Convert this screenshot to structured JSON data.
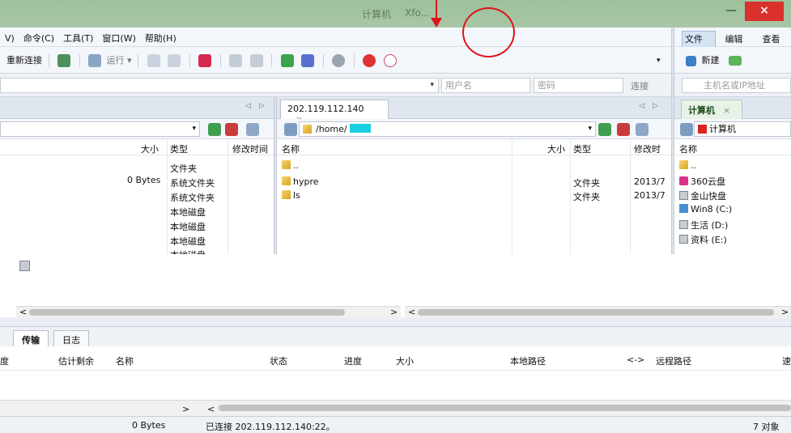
{
  "window": {
    "title_faint": "计算机",
    "title_faint2": "Xfo...",
    "min_glyph": "—",
    "max_glyph": "☐",
    "close_glyph": "×"
  },
  "menu": [
    "V)",
    "命令(C)",
    "工具(T)",
    "窗口(W)",
    "帮助(H)"
  ],
  "right_menu": [
    "文件(F)",
    "编辑(E)",
    "查看("
  ],
  "toolbar": {
    "reconnect": "重新连接",
    "run": "运行 ▾",
    "dropdown_glyph": "▾"
  },
  "right_toolbar": {
    "new": "新建"
  },
  "connect": {
    "username_placeholder": "用户名",
    "password_placeholder": "密码",
    "connect_label": "连接",
    "host_placeholder": "主机名或IP地址"
  },
  "left_pane": {
    "columns": {
      "size": "大小",
      "type": "类型",
      "modified": "修改时间"
    },
    "rows": [
      {
        "size": "",
        "type": "文件夹"
      },
      {
        "size": "0 Bytes",
        "type": "系统文件夹"
      },
      {
        "size": "",
        "type": "系统文件夹"
      },
      {
        "size": "",
        "type": "本地磁盘"
      },
      {
        "size": "",
        "type": "本地磁盘"
      },
      {
        "size": "",
        "type": "本地磁盘"
      },
      {
        "size": "",
        "type": "本地磁盘"
      }
    ]
  },
  "remote_pane": {
    "tab": "202.119.112.140",
    "tab_close": "×",
    "path": "/home/",
    "columns": {
      "name": "名称",
      "size": "大小",
      "type": "类型",
      "modified": "修改时"
    },
    "rows": [
      {
        "name": "..",
        "type": "",
        "modified": ""
      },
      {
        "name": "hypre",
        "type": "文件夹",
        "modified": "2013/7"
      },
      {
        "name": "ls",
        "type": "文件夹",
        "modified": "2013/7"
      }
    ]
  },
  "right_pane": {
    "tab": "计算机",
    "tab_close": "×",
    "path": "计算机",
    "column_name": "名称",
    "items": [
      "..",
      "360云盘",
      "金山快盘",
      "Win8 (C:)",
      "生活 (D:)",
      "资料 (E:)"
    ]
  },
  "transfer": {
    "tabs": [
      "传输",
      "日志"
    ],
    "columns": [
      "度",
      "估计剩余",
      "名称",
      "状态",
      "进度",
      "大小",
      "本地路径",
      "<->",
      "远程路径",
      "速"
    ]
  },
  "scroll": {
    "left_arrow": "<",
    "right_arrow": ">"
  },
  "status": {
    "left": "0 Bytes",
    "connected": "已连接 202.119.112.140:22。",
    "objects": "7 对象"
  },
  "colors": {
    "annotation": "#e0111b",
    "close_button": "#d9312b"
  }
}
